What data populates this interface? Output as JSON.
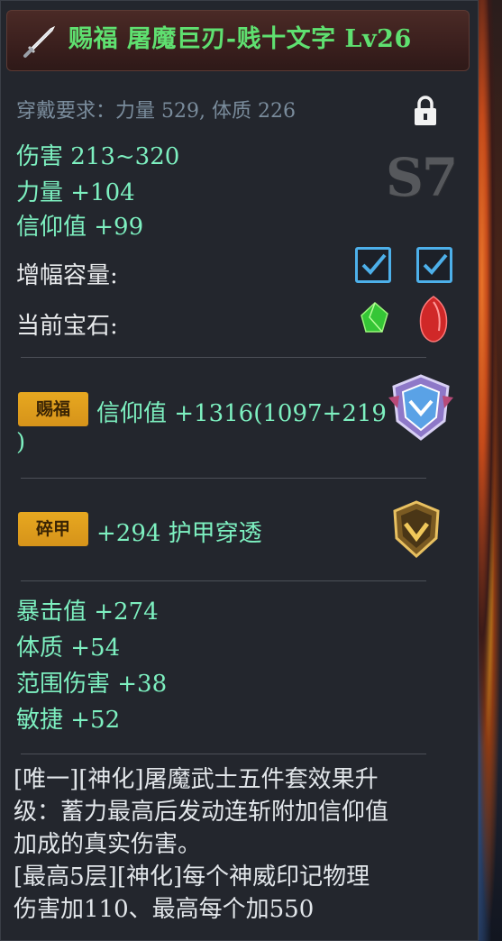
{
  "title": "赐福 屠魔巨刃-贱十文字 Lv26",
  "requirement": "穿戴要求：力量 529, 体质 226",
  "grade": "S7",
  "base_stats": [
    "伤害  213~320",
    "力量 +104",
    "信仰值 +99"
  ],
  "amplify_label": "增幅容量:",
  "gem_label": "当前宝石:",
  "blessing": {
    "badge": "赐福",
    "text_line1": "信仰值 +1316(1097+219",
    "text_line2": ")"
  },
  "armor_break": {
    "badge": "碎甲",
    "text": "+294 护甲穿透"
  },
  "extra_stats": [
    "暴击值 +274",
    "体质 +54",
    "范围伤害 +38",
    "敏捷 +52"
  ],
  "description_lines": [
    "[唯一][神化]屠魔武士五件套效果升",
    "级：蓄力最高后发动连斩附加信仰值",
    "加成的真实伤害。",
    "[最高5层][神化]每个神威印记物理",
    "伤害加110、最高每个加550"
  ],
  "colors": {
    "title_green": "#5fe070",
    "stat_green": "#7df0c0",
    "badge_gold": "#e7a820",
    "check_blue": "#4db0ea"
  },
  "icons": {
    "weapon": "sword-icon",
    "lock": "lock-icon",
    "gem_green": "green-gem-icon",
    "gem_red": "red-gem-icon",
    "blessing": "blessing-shield-icon",
    "armor_break": "armor-break-shield-icon"
  }
}
